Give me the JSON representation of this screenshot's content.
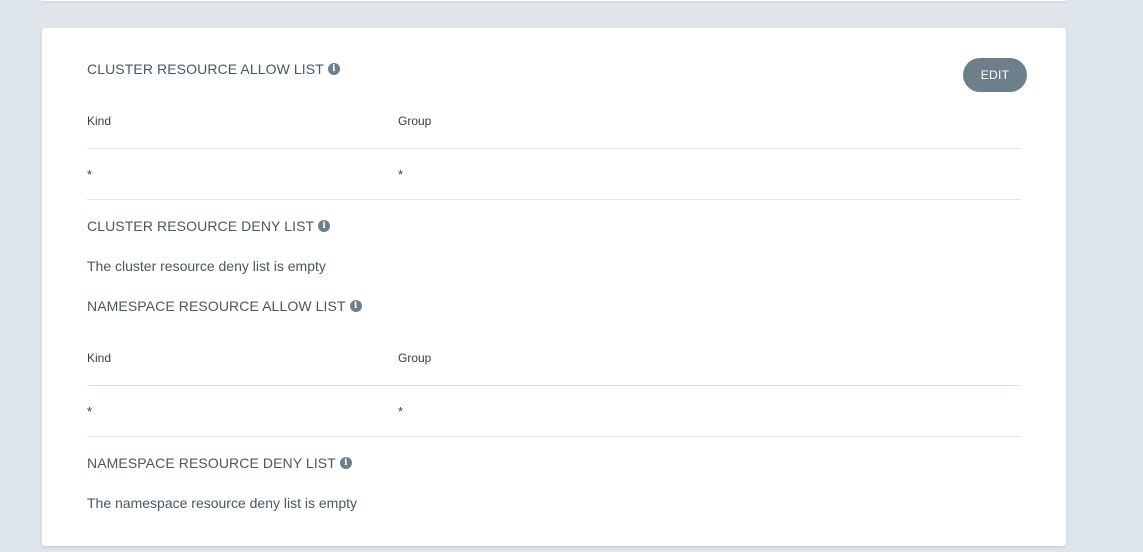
{
  "cluster_allow": {
    "title": "CLUSTER RESOURCE ALLOW LIST",
    "edit_label": "EDIT",
    "columns": [
      "Kind",
      "Group"
    ],
    "rows": [
      {
        "kind": "*",
        "group": "*"
      }
    ]
  },
  "cluster_deny": {
    "title": "CLUSTER RESOURCE DENY LIST",
    "empty_text": "The cluster resource deny list is empty"
  },
  "namespace_allow": {
    "title": "NAMESPACE RESOURCE ALLOW LIST",
    "columns": [
      "Kind",
      "Group"
    ],
    "rows": [
      {
        "kind": "*",
        "group": "*"
      }
    ]
  },
  "namespace_deny": {
    "title": "NAMESPACE RESOURCE DENY LIST",
    "empty_text": "The namespace resource deny list is empty"
  },
  "icons": {
    "info": "info-icon"
  },
  "colors": {
    "background": "#dee6eb",
    "card": "#ffffff",
    "button": "#6d7f8b",
    "text": "#495763"
  }
}
